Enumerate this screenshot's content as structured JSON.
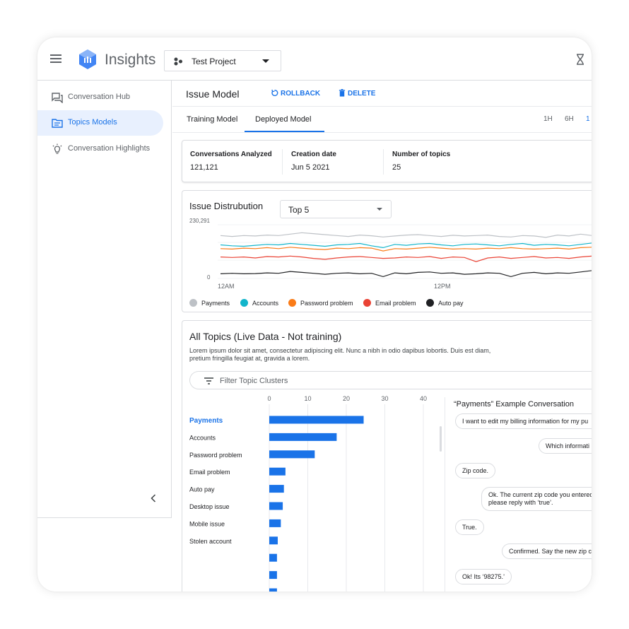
{
  "app": {
    "title": "Insights"
  },
  "project": {
    "name": "Test Project"
  },
  "sidebar": {
    "items": [
      {
        "label": "Conversation Hub",
        "icon": "forum-icon"
      },
      {
        "label": "Topics Models",
        "icon": "folder-icon",
        "active": true
      },
      {
        "label": "Conversation Highlights",
        "icon": "lightbulb-icon"
      }
    ]
  },
  "header": {
    "title": "Issue Model",
    "rollback_label": "ROLLBACK",
    "delete_label": "DELETE"
  },
  "tabs": {
    "items": [
      "Training Model",
      "Deployed Model"
    ],
    "active": 1
  },
  "time_ranges": [
    "1H",
    "6H",
    "1"
  ],
  "stats": [
    {
      "label": "Conversations Analyzed",
      "value": "121,121"
    },
    {
      "label": "Creation date",
      "value": "Jun 5 2021"
    },
    {
      "label": "Number of topics",
      "value": "25"
    }
  ],
  "issue": {
    "title": "Issue Distrubution",
    "select_value": "Top 5",
    "legend": [
      {
        "label": "Payments",
        "color": "#bdc1c6"
      },
      {
        "label": "Accounts",
        "color": "#12b5cb"
      },
      {
        "label": "Password problem",
        "color": "#fa7b17"
      },
      {
        "label": "Email problem",
        "color": "#ea4335"
      },
      {
        "label": "Auto pay",
        "color": "#202124"
      }
    ]
  },
  "topics": {
    "title": "All Topics (Live Data - Not training)",
    "description": "Lorem ipsum dolor sit amet, consectetur adipiscing elit. Nunc a nibh in odio dapibus lobortis. Duis est diam, pretium fringilla feugiat at, gravida a lorem.",
    "filter_label": "Filter Topic Clusters",
    "selected_label": "Payments"
  },
  "conversation": {
    "title": "“Payments” Example Conversation",
    "messages": [
      {
        "text": "I want to edit my billing information for my pu",
        "side": "left"
      },
      {
        "text": "Which informati",
        "side": "right"
      },
      {
        "text": "Zip code.",
        "side": "left"
      },
      {
        "text": "Ok. The current zip code you entered",
        "text2": "please reply with ‘true’.",
        "side": "right"
      },
      {
        "text": "True.",
        "side": "left"
      },
      {
        "text": "Confirmed. Say the new zip co",
        "side": "right"
      },
      {
        "text": "Ok! Its ‘98275.’",
        "side": "left"
      }
    ]
  },
  "chart_data": [
    {
      "type": "line",
      "title": "Issue Distrubution",
      "ylim": [
        0,
        230291
      ],
      "ytick_labels": [
        "230,291",
        "0"
      ],
      "xtick_labels": [
        "12AM",
        "12PM"
      ],
      "grid": true,
      "legend_position": "bottom",
      "series": [
        {
          "name": "Payments",
          "color": "#bdc1c6",
          "values": [
            184000,
            180000,
            184000,
            182000,
            186000,
            184000,
            190000,
            196000,
            192000,
            188000,
            184000,
            180000,
            186000,
            183000,
            178000,
            182000,
            186000,
            188000,
            184000,
            180000,
            185000,
            182000,
            184000,
            186000,
            180000,
            178000,
            184000,
            182000,
            176000,
            186000,
            182000,
            190000,
            184000
          ]
        },
        {
          "name": "Accounts",
          "color": "#12b5cb",
          "values": [
            144000,
            140000,
            138000,
            142000,
            146000,
            144000,
            150000,
            146000,
            142000,
            138000,
            144000,
            146000,
            150000,
            140000,
            132000,
            146000,
            142000,
            148000,
            150000,
            144000,
            140000,
            146000,
            148000,
            144000,
            140000,
            146000,
            150000,
            142000,
            146000,
            144000,
            140000,
            146000,
            152000
          ]
        },
        {
          "name": "Password problem",
          "color": "#fa7b17",
          "values": [
            128000,
            126000,
            130000,
            128000,
            132000,
            128000,
            134000,
            130000,
            126000,
            124000,
            130000,
            128000,
            132000,
            130000,
            118000,
            128000,
            126000,
            130000,
            134000,
            130000,
            126000,
            128000,
            126000,
            130000,
            128000,
            132000,
            128000,
            126000,
            128000,
            130000,
            126000,
            132000,
            134000
          ]
        },
        {
          "name": "Email problem",
          "color": "#ea4335",
          "values": [
            92000,
            90000,
            92000,
            88000,
            94000,
            92000,
            96000,
            92000,
            86000,
            82000,
            88000,
            92000,
            94000,
            90000,
            86000,
            88000,
            92000,
            90000,
            94000,
            86000,
            92000,
            90000,
            72000,
            88000,
            92000,
            86000,
            90000,
            94000,
            88000,
            90000,
            86000,
            92000,
            96000
          ]
        },
        {
          "name": "Auto pay",
          "color": "#202124",
          "values": [
            20000,
            22000,
            20000,
            21000,
            24000,
            22000,
            30000,
            26000,
            22000,
            18000,
            22000,
            24000,
            20000,
            22000,
            8000,
            24000,
            20000,
            26000,
            28000,
            22000,
            24000,
            18000,
            20000,
            24000,
            22000,
            8000,
            22000,
            26000,
            20000,
            24000,
            22000,
            28000,
            34000
          ]
        }
      ]
    },
    {
      "type": "bar",
      "orientation": "horizontal",
      "categories": [
        "Payments",
        "Accounts",
        "Password problem",
        "Email problem",
        "Auto pay",
        "Desktop issue",
        "Mobile issue",
        "Stolen account",
        "",
        "",
        ""
      ],
      "values": [
        24.5,
        17.5,
        11.8,
        4.2,
        3.8,
        3.5,
        3.0,
        2.2,
        2.0,
        2.0,
        2.0
      ],
      "xlim": [
        0,
        40
      ],
      "xticks": [
        0,
        10,
        20,
        30,
        40
      ],
      "color": "#1a73e8"
    }
  ]
}
